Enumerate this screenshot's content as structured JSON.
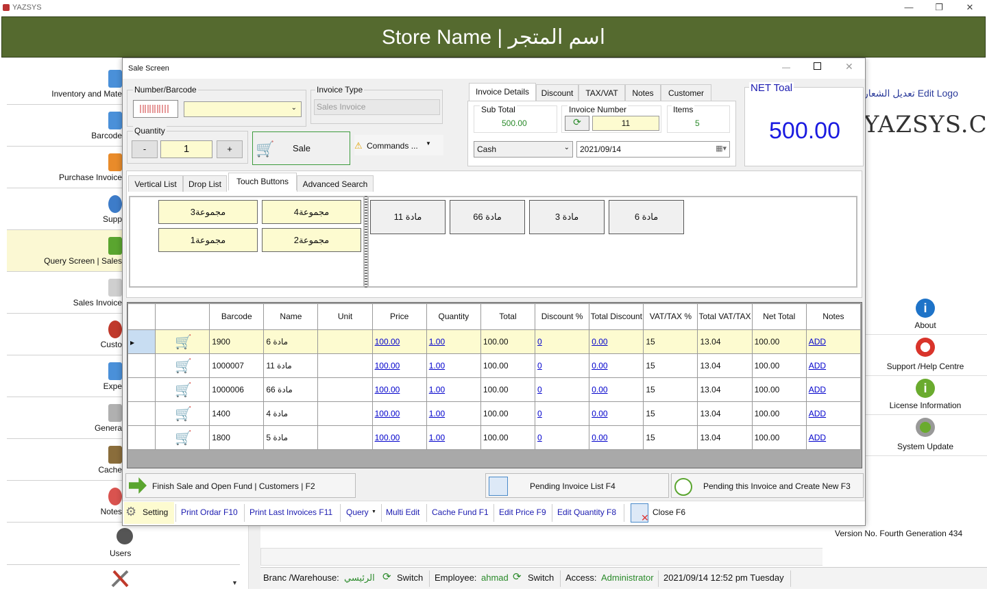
{
  "app": {
    "title": "YAZSYS",
    "banner": "Store Name | اسم المتجر"
  },
  "sidebar": {
    "items": [
      {
        "label": "Inventory and Mate"
      },
      {
        "label": "Barcode"
      },
      {
        "label": "Purchase Invoice"
      },
      {
        "label": "Supp"
      },
      {
        "label": "Query Screen | Sales"
      },
      {
        "label": "Sales Invoice"
      },
      {
        "label": "Custo"
      },
      {
        "label": "Expe"
      },
      {
        "label": "Genera"
      },
      {
        "label": "Cache"
      },
      {
        "label": "Notes"
      },
      {
        "label": "Users"
      }
    ]
  },
  "right_panel": {
    "edit_logo": "تعديل الشعار Edit Logo",
    "logo_text": "YAZSYS.COM",
    "items": [
      {
        "label": "About"
      },
      {
        "label": "Support /Help Centre"
      },
      {
        "label": "License Information"
      },
      {
        "label": "System Update"
      }
    ],
    "version": "Version No.  Fourth Generation 434"
  },
  "statusbar": {
    "branch_label": "Branc /Warehouse:",
    "branch_value": "الرئيسي",
    "switch1": "Switch",
    "employee_label": "Employee:",
    "employee_value": "ahmad",
    "switch2": "Switch",
    "access_label": "Access:",
    "access_value": "Administrator",
    "datetime": "2021/09/14 12:52 pm Tuesday"
  },
  "dialog": {
    "title": "Sale Screen",
    "number_barcode_label": "Number/Barcode",
    "invoice_type_label": "Invoice Type",
    "invoice_type_value": "Sales Invoice",
    "quantity_label": "Quantity",
    "quantity_value": "1",
    "minus": "-",
    "plus": "+",
    "sale_button": "Sale",
    "commands_button": "Commands ...",
    "tabs_top": [
      "Invoice Details",
      "Discount",
      "TAX/VAT",
      "Notes",
      "Customer"
    ],
    "subtotal_label": "Sub Total",
    "subtotal_value": "500.00",
    "invoice_number_label": "Invoice Number",
    "invoice_number_value": "11",
    "items_label": "Items",
    "items_value": "5",
    "payment_value": "Cash",
    "date_value": "2021/09/14",
    "net_total_label": "NET Toal",
    "net_total_value": "500.00",
    "tabs_mid": [
      "Vertical List",
      "Drop List",
      "Touch Buttons",
      "Advanced Search"
    ],
    "groups": [
      "مجموعة3",
      "مجموعة4",
      "مجموعة1",
      "مجموعة2"
    ],
    "products": [
      "مادة 11",
      "مادة 66",
      "مادة 3",
      "مادة 6"
    ],
    "grid_headers": [
      "",
      "Barcode",
      "Name",
      "Unit",
      "Price",
      "Quantity",
      "Total",
      "Discount %",
      "Total Discount",
      "VAT/TAX %",
      "Total VAT/TAX",
      "Net Total",
      "Notes"
    ],
    "grid_rows": [
      {
        "barcode": "1900",
        "name": "مادة 6",
        "unit": "",
        "price": "100.00",
        "qty": "1.00",
        "total": "100.00",
        "disc": "0",
        "tdisc": "0.00",
        "vat": "15",
        "tvat": "13.04",
        "net": "100.00",
        "notes": "ADD"
      },
      {
        "barcode": "1000007",
        "name": "مادة 11",
        "unit": "",
        "price": "100.00",
        "qty": "1.00",
        "total": "100.00",
        "disc": "0",
        "tdisc": "0.00",
        "vat": "15",
        "tvat": "13.04",
        "net": "100.00",
        "notes": "ADD"
      },
      {
        "barcode": "1000006",
        "name": "مادة 66",
        "unit": "",
        "price": "100.00",
        "qty": "1.00",
        "total": "100.00",
        "disc": "0",
        "tdisc": "0.00",
        "vat": "15",
        "tvat": "13.04",
        "net": "100.00",
        "notes": "ADD"
      },
      {
        "barcode": "1400",
        "name": "مادة 4",
        "unit": "",
        "price": "100.00",
        "qty": "1.00",
        "total": "100.00",
        "disc": "0",
        "tdisc": "0.00",
        "vat": "15",
        "tvat": "13.04",
        "net": "100.00",
        "notes": "ADD"
      },
      {
        "barcode": "1800",
        "name": "مادة 5",
        "unit": "",
        "price": "100.00",
        "qty": "1.00",
        "total": "100.00",
        "disc": "0",
        "tdisc": "0.00",
        "vat": "15",
        "tvat": "13.04",
        "net": "100.00",
        "notes": "ADD"
      }
    ],
    "finish_button": "Finish Sale and Open Fund | Customers | F2",
    "pending_list_button": "Pending  Invoice List F4",
    "pending_new_button": "Pending this Invoice and Create New F3",
    "bottom_links": [
      "Setting",
      "Print Ordar F10",
      "Print Last Invoices F11",
      "Query",
      "Multi Edit",
      "Cache Fund F1",
      "Edit Price F9",
      "Edit Quantity F8",
      "Close F6"
    ]
  }
}
